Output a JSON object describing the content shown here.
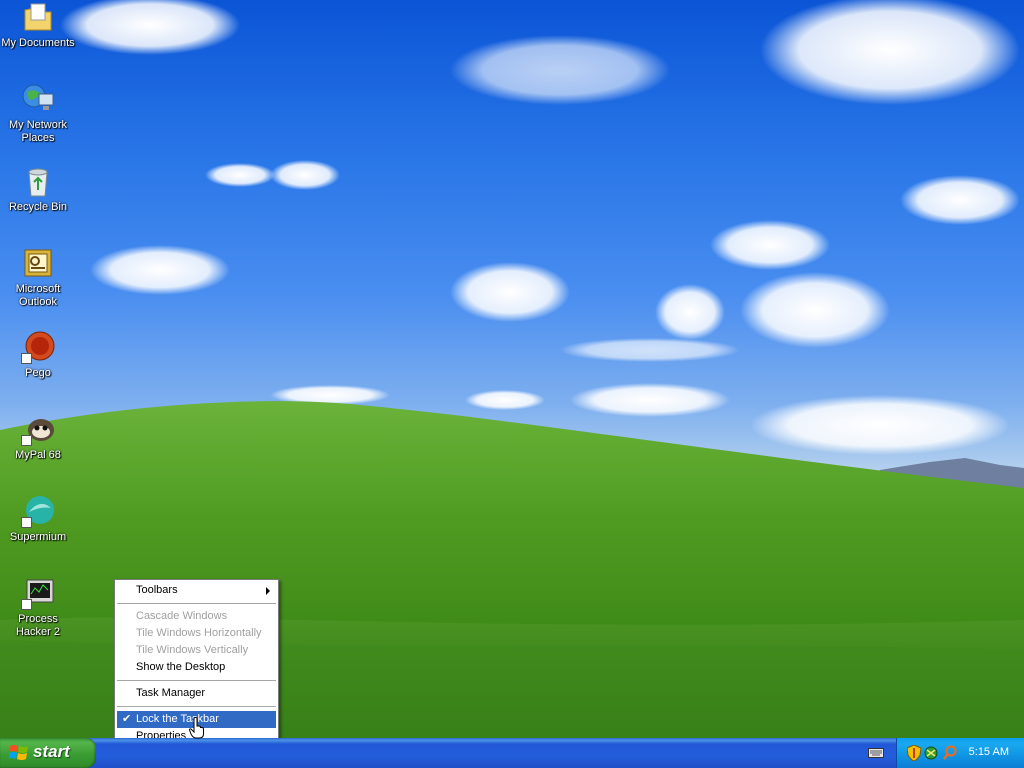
{
  "desktop": {
    "icons": [
      {
        "label": "My Documents",
        "icon": "my-documents-icon"
      },
      {
        "label": "My Network Places",
        "icon": "network-places-icon"
      },
      {
        "label": "Recycle Bin",
        "icon": "recycle-bin-icon"
      },
      {
        "label": "Microsoft Outlook",
        "icon": "outlook-icon"
      },
      {
        "label": "Pego",
        "icon": "pego-icon"
      },
      {
        "label": "MyPal 68",
        "icon": "mypal-icon"
      },
      {
        "label": "Supermium",
        "icon": "supermium-icon"
      },
      {
        "label": "Process Hacker 2",
        "icon": "process-hacker-icon"
      }
    ]
  },
  "context_menu": {
    "items": [
      {
        "label": "Toolbars",
        "state": "normal",
        "submenu": true
      },
      {
        "label": "Cascade Windows",
        "state": "disabled"
      },
      {
        "label": "Tile Windows Horizontally",
        "state": "disabled"
      },
      {
        "label": "Tile Windows Vertically",
        "state": "disabled"
      },
      {
        "label": "Show the Desktop",
        "state": "normal"
      },
      {
        "label": "Task Manager",
        "state": "normal"
      },
      {
        "label": "Lock the Taskbar",
        "state": "highlighted",
        "checked": true
      },
      {
        "label": "Properties",
        "state": "normal"
      }
    ]
  },
  "taskbar": {
    "start_label": "start",
    "clock": "5:15 AM",
    "tray_icons": [
      "security-shield-icon",
      "network-icon",
      "search-icon"
    ]
  },
  "colors": {
    "taskbar_blue": "#245edb",
    "start_green": "#3a9d33",
    "tray_blue": "#0f8ee0",
    "menu_highlight": "#316ac5"
  }
}
